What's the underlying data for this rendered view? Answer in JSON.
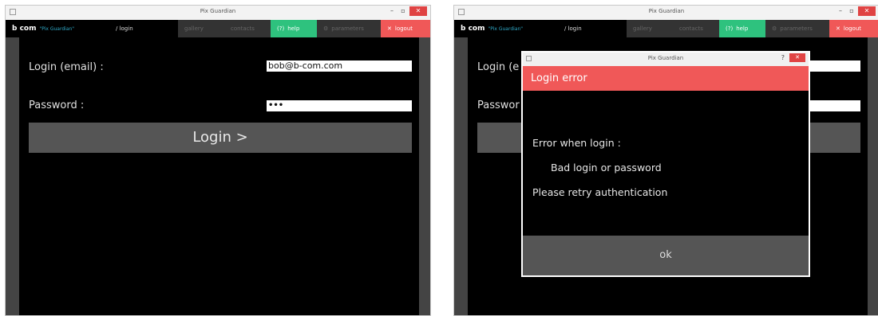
{
  "window": {
    "title": "Pix Guardian",
    "min": "–",
    "max": "▫",
    "close": "✕"
  },
  "nav": {
    "brand": "b com",
    "brand_sub": "\"Pix Guardian\"",
    "login": "/ login",
    "gallery": "gallery",
    "contacts": "contacts",
    "help": "help",
    "help_icon": "(?)",
    "parameters": "parameters",
    "parameters_icon": "⚙",
    "logout": "logout",
    "logout_icon": "✕"
  },
  "form": {
    "email_label": "Login (email) :",
    "email_value": "bob@b-com.com",
    "password_label": "Password :",
    "password_value": "•••",
    "login_button": "Login >"
  },
  "form_partial": {
    "email_label": "Login (e",
    "password_label": "Passwor"
  },
  "dialog": {
    "title": "Pix Guardian",
    "help": "?",
    "close": "✕",
    "header": "Login error",
    "line1": "Error when login :",
    "line2": "Bad login or password",
    "line3": "Please retry authentication",
    "ok": "ok"
  },
  "colors": {
    "logout": "#f05858",
    "help": "#2ec27e",
    "brand_sub": "#2fa9c7"
  }
}
